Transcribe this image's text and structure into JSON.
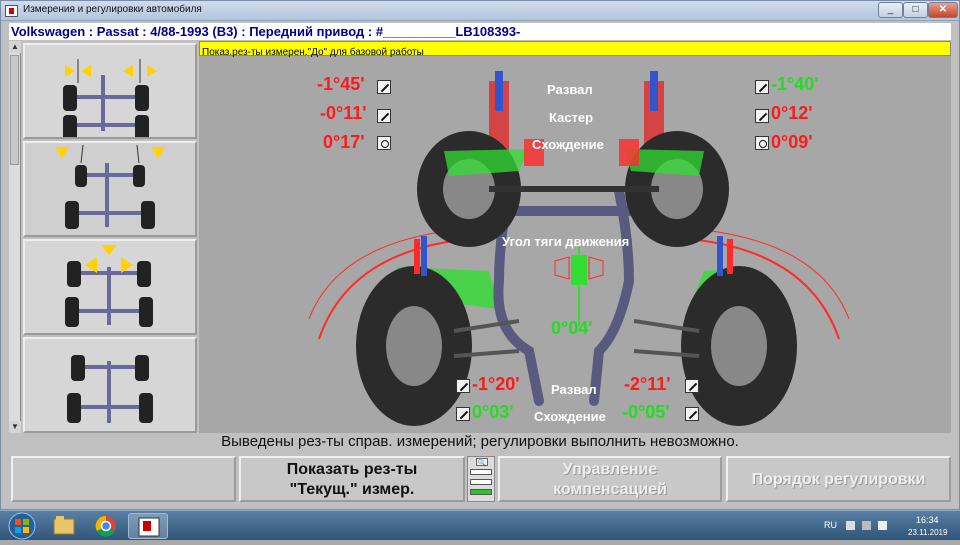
{
  "window": {
    "title": "Измерения и регулировки автомобиля",
    "min": "_",
    "max": "□",
    "close": "✕"
  },
  "vehicle_header": "Volkswagen : Passat : 4/88-1993 (B3) : Передний привод : #__________LB108393-",
  "status_strip": "Показ.рез-ты измерен.\"До\" для базовой работы",
  "front": {
    "labels": {
      "camber": "Развал",
      "caster": "Кастер",
      "toe": "Схождение"
    },
    "left": {
      "camber": "-1°45'",
      "caster": "-0°11'",
      "toe": "0°17'"
    },
    "right": {
      "camber": "-1°40'",
      "caster": "0°12'",
      "toe": "0°09'"
    }
  },
  "thrust": {
    "label": "Угол тяги движения",
    "value": "0°04'"
  },
  "rear": {
    "labels": {
      "camber": "Развал",
      "toe": "Схождение"
    },
    "left": {
      "camber": "-1°20'",
      "toe": "0°03'"
    },
    "right": {
      "camber": "-2°11'",
      "toe": "-0°05'"
    }
  },
  "message": "Выведены рез-ты справ. измерений; регулировки выполнить невозможно.",
  "buttons": {
    "f1": "",
    "f2_line1": "Показать рез-ты",
    "f2_line2": "\"Текущ.\" измер.",
    "f4_line1": "Управление",
    "f4_line2": "компенсацией",
    "f5": "Порядок регулировки"
  },
  "taskbar": {
    "lang": "RU",
    "time": "16:34",
    "date": "23.11.2019"
  },
  "colors": {
    "out_of_spec": "#ff1a1a",
    "in_spec": "#22dd22",
    "status_yellow": "#ffff00",
    "header_text": "#00008b"
  },
  "icons": {
    "adjust": "adjust-wrench-icon",
    "target": "target-icon"
  }
}
